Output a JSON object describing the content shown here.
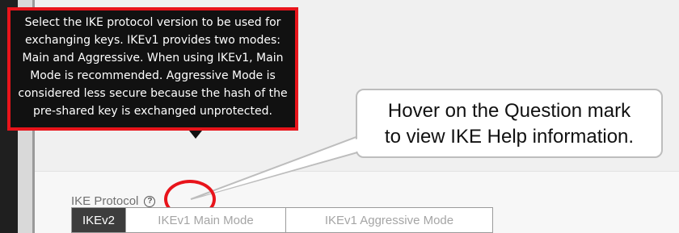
{
  "tooltip": {
    "text": "Select the IKE protocol version to be used for exchanging keys. IKEv1 provides two modes: Main and Aggressive. When using IKEv1, Main Mode is recommended. Aggressive Mode is considered less secure because the hash of the pre-shared key is exchanged unprotected."
  },
  "callout": {
    "line1": "Hover on the Question mark",
    "line2": "to view IKE Help information."
  },
  "field": {
    "label": "IKE Protocol",
    "help_icon": "?"
  },
  "ike_protocol": {
    "options": [
      "IKEv2",
      "IKEv1 Main Mode",
      "IKEv1 Aggressive Mode"
    ],
    "selected": "IKEv2"
  },
  "colors": {
    "highlight": "#e8141b",
    "tooltip_bg": "#111111",
    "active_segment": "#3d3d3d"
  }
}
